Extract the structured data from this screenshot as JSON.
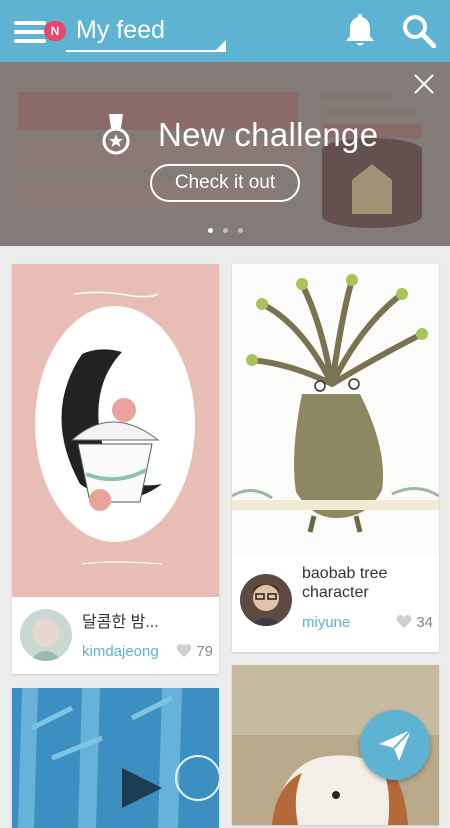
{
  "header": {
    "badge": "N",
    "feed_title": "My feed"
  },
  "banner": {
    "title": "New challenge",
    "cta": "Check it out",
    "slides": 3,
    "active_slide": 1
  },
  "posts": [
    {
      "title": "달콤한 밤...",
      "author": "kimdajeong",
      "likes": "79"
    },
    {
      "title": "baobab tree character",
      "author": "miyune",
      "likes": "34"
    }
  ],
  "colors": {
    "accent": "#5eb3d2",
    "badge": "#e8476a"
  },
  "icons": {
    "menu": "menu-icon",
    "bell": "bell-icon",
    "search": "search-icon",
    "close": "close-icon",
    "medal": "medal-icon",
    "heart": "heart-icon",
    "send": "send-icon"
  }
}
